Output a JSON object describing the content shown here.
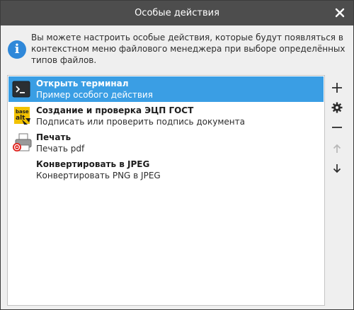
{
  "window": {
    "title": "Особые действия"
  },
  "info": {
    "text": "Вы можете настроить особые действия, которые будут появляться в контекстном меню файлового менеджера при выборе определённых типов файлов."
  },
  "actions": [
    {
      "title": "Открыть терминал",
      "subtitle": "Пример особого действия",
      "icon": "terminal-icon",
      "selected": true
    },
    {
      "title": "Создание и проверка ЭЦП ГОСТ",
      "subtitle": "Подписать или проверить подпись документа",
      "icon": "basealt-logo-icon",
      "selected": false
    },
    {
      "title": "Печать",
      "subtitle": "Печать pdf",
      "icon": "printer-pdf-icon",
      "selected": false
    },
    {
      "title": "Конвертировать в JPEG",
      "subtitle": "Конвертировать PNG в JPEG",
      "icon": "none",
      "selected": false
    }
  ],
  "logo_text": {
    "line1": "base",
    "line2": "alt"
  },
  "side_buttons": [
    "add-icon",
    "gear-icon",
    "remove-icon",
    "arrow-up-icon",
    "arrow-down-icon"
  ],
  "colors": {
    "titlebar": "#4d4d4d",
    "selection": "#3a9ee4",
    "info_icon": "#2f88d9",
    "background": "#efefef"
  }
}
